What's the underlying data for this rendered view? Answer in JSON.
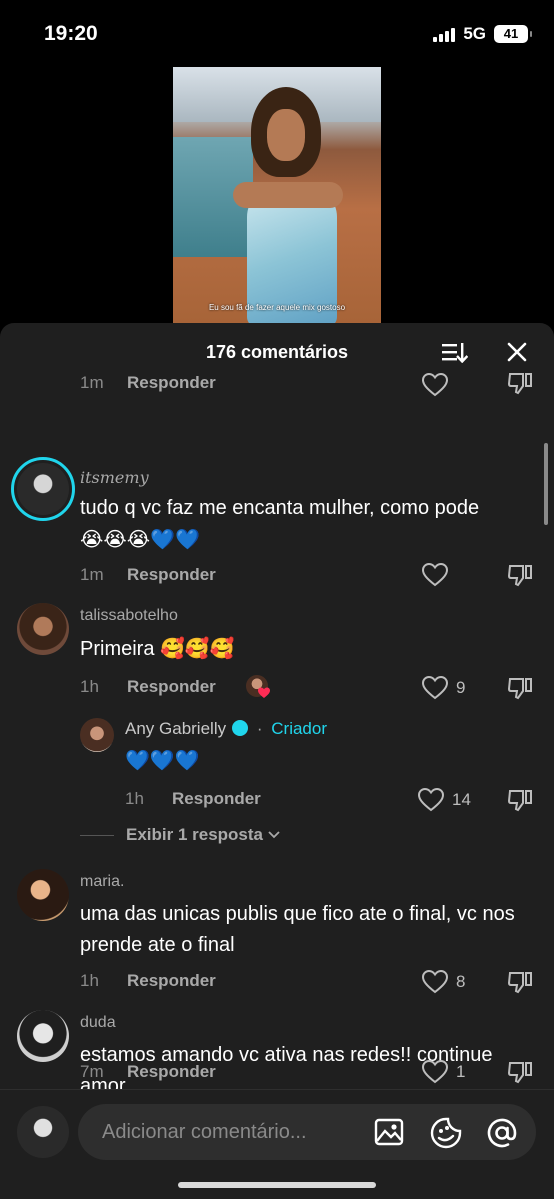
{
  "status": {
    "time": "19:20",
    "network": "5G",
    "battery": "41"
  },
  "video": {
    "caption": "Eu sou fã de fazer aquele mix gostoso"
  },
  "sheet": {
    "title": "176 comentários"
  },
  "partial": {
    "time": "1m",
    "reply": "Responder"
  },
  "comments": [
    {
      "username": "itsmemy",
      "text": "tudo q vc faz me encanta mulher, como pode",
      "emojis": "😭😭😭💙💙",
      "time": "1m",
      "reply": "Responder",
      "likes": ""
    },
    {
      "username": "talissabotelho",
      "text": "Primeira",
      "emojis": "🥰🥰🥰",
      "time": "1h",
      "reply": "Responder",
      "likes": "9"
    },
    {
      "username": "maria.",
      "text": "uma das unicas publis que fico ate o final, vc nos prende ate o final",
      "time": "1h",
      "reply": "Responder",
      "likes": "8"
    },
    {
      "username": "duda",
      "text": "estamos amando vc ativa nas redes!! continue amor",
      "time": "7m",
      "reply": "Responder",
      "likes": "1"
    }
  ],
  "creator_reply": {
    "username": "Any Gabrielly",
    "separator": "·",
    "badge_label": "Criador",
    "emojis": "💙💙💙",
    "time": "1h",
    "reply": "Responder",
    "likes": "14"
  },
  "view_replies": {
    "label": "Exibir 1 resposta"
  },
  "input": {
    "placeholder": "Adicionar comentário..."
  },
  "colors": {
    "background": "#1f1f1f",
    "accent": "#20d5ec",
    "muted_text": "#a9a9a9",
    "like_red": "#fe2c55"
  },
  "icons": [
    "sort-icon",
    "close-icon",
    "heart-outline-icon",
    "dislike-icon",
    "image-icon",
    "sticker-icon",
    "at-icon"
  ]
}
